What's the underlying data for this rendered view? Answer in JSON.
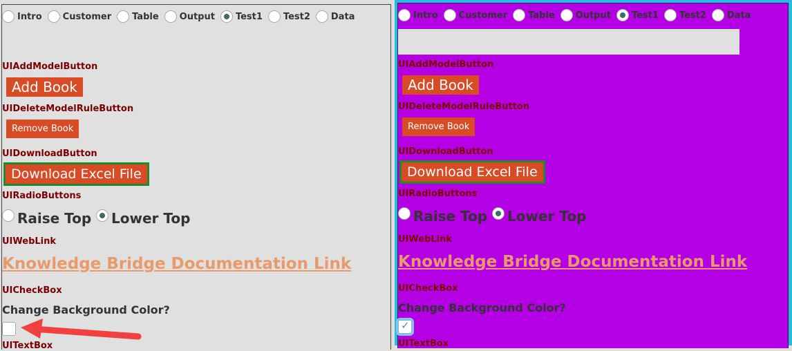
{
  "tabs": [
    {
      "label": "Intro",
      "selected": false
    },
    {
      "label": "Customer",
      "selected": false
    },
    {
      "label": "Table",
      "selected": false
    },
    {
      "label": "Output",
      "selected": false
    },
    {
      "label": "Test1",
      "selected": true
    },
    {
      "label": "Test2",
      "selected": false
    },
    {
      "label": "Data",
      "selected": false
    }
  ],
  "sections": {
    "add_model_label": "UIAddModelButton",
    "add_book": "Add Book",
    "delete_rule_label": "UIDeleteModelRuleButton",
    "remove_book": "Remove Book",
    "download_label": "UIDownloadButton",
    "download": "Download Excel File",
    "radio_label": "UIRadioButtons",
    "radio_options": [
      {
        "label": "Raise Top",
        "selected": false
      },
      {
        "label": "Lower Top",
        "selected": true
      }
    ],
    "weblink_label": "UIWebLink",
    "weblink": "Knowledge Bridge Documentation Link",
    "checkbox_label": "UICheckBox",
    "checkbox_question": "Change Background Color?",
    "textbox_label": "UITextBox"
  },
  "left_panel": {
    "checkbox_checked": false,
    "background": "#e0e0e0"
  },
  "right_panel": {
    "checkbox_checked": true,
    "background": "#b500e6",
    "frame_color": "#29b9e6"
  },
  "colors": {
    "button": "#d94b25",
    "download_border": "#1f8a2e",
    "label": "#7a0000",
    "link": "#e89a6a",
    "arrow": "#f04040"
  }
}
